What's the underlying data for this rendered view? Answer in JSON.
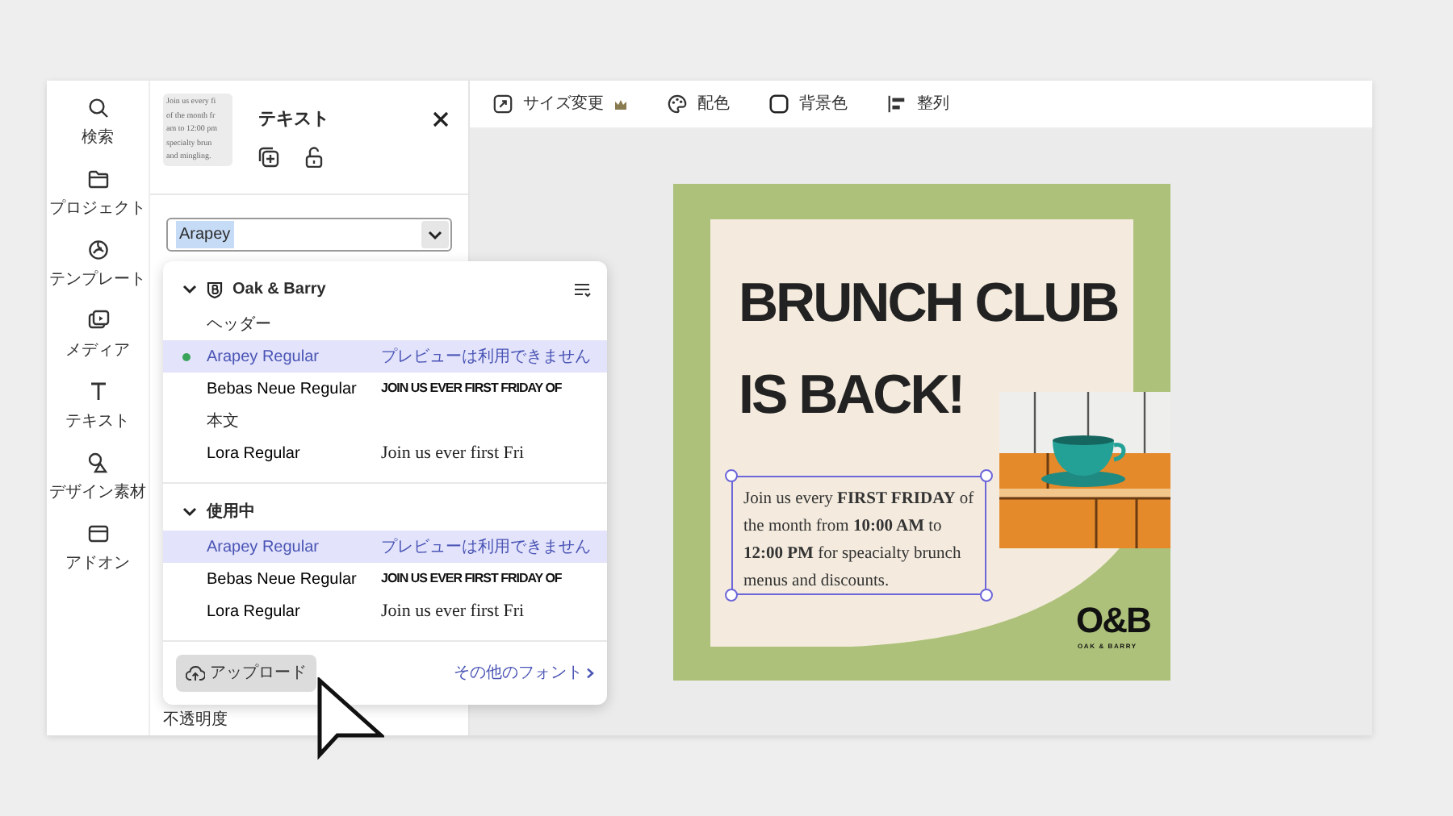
{
  "rail": [
    {
      "label": "検索"
    },
    {
      "label": "プロジェクト"
    },
    {
      "label": "テンプレート"
    },
    {
      "label": "メディア"
    },
    {
      "label": "テキスト"
    },
    {
      "label": "デザイン素材"
    },
    {
      "label": "アドオン"
    }
  ],
  "toolbar": [
    {
      "label": "サイズ変更",
      "premium": true
    },
    {
      "label": "配色",
      "premium": false
    },
    {
      "label": "背景色",
      "premium": false
    },
    {
      "label": "整列",
      "premium": false
    }
  ],
  "panel": {
    "thumbnail_lines": [
      "Join us every fi",
      "of the month fr",
      "am to 12:00 pm",
      "specialty brun",
      "and mingling."
    ],
    "title": "テキスト",
    "font_select": {
      "value": "Arapey",
      "text_selected": true
    },
    "opacity_label": "不透明度"
  },
  "font_menu": {
    "sections": [
      {
        "title": "Oak & Barry",
        "kind": "brand",
        "expanded": true,
        "groups": [
          {
            "label": "ヘッダー",
            "fonts": [
              {
                "name": "Arapey Regular",
                "preview": "プレビューは利用できません",
                "kind": "unavailable",
                "selected": true,
                "current": true
              },
              {
                "name": "Bebas Neue Regular",
                "preview": "JOIN US EVER FIRST FRIDAY OF",
                "kind": "display",
                "selected": false,
                "current": false
              }
            ]
          },
          {
            "label": "本文",
            "fonts": [
              {
                "name": "Lora Regular",
                "preview": "Join us ever first Fri",
                "kind": "serif",
                "selected": false,
                "current": false
              }
            ]
          }
        ]
      },
      {
        "title": "使用中",
        "kind": "plain",
        "expanded": true,
        "groups": [
          {
            "fonts": [
              {
                "name": "Arapey Regular",
                "preview": "プレビューは利用できません",
                "kind": "unavailable",
                "selected": true,
                "current": false
              },
              {
                "name": "Bebas Neue Regular",
                "preview": "JOIN US EVER FIRST FRIDAY OF",
                "kind": "display",
                "selected": false,
                "current": false
              },
              {
                "name": "Lora Regular",
                "preview": "Join us ever first Fri",
                "kind": "serif",
                "selected": false,
                "current": false
              }
            ]
          }
        ]
      }
    ],
    "upload_button": "アップロード",
    "more_link": "その他のフォント"
  },
  "poster": {
    "headline": [
      "BRUNCH CLUB",
      "IS BACK!"
    ],
    "body": "Join us every **FIRST FRIDAY** of the month from **10:00 AM** to **12:00 PM** for speacialty brunch menus and discounts.",
    "body_selected": true,
    "photo": {
      "kind": "picture"
    },
    "logo": {
      "mark": "O&B",
      "tagline": "OAK & BARRY"
    }
  }
}
